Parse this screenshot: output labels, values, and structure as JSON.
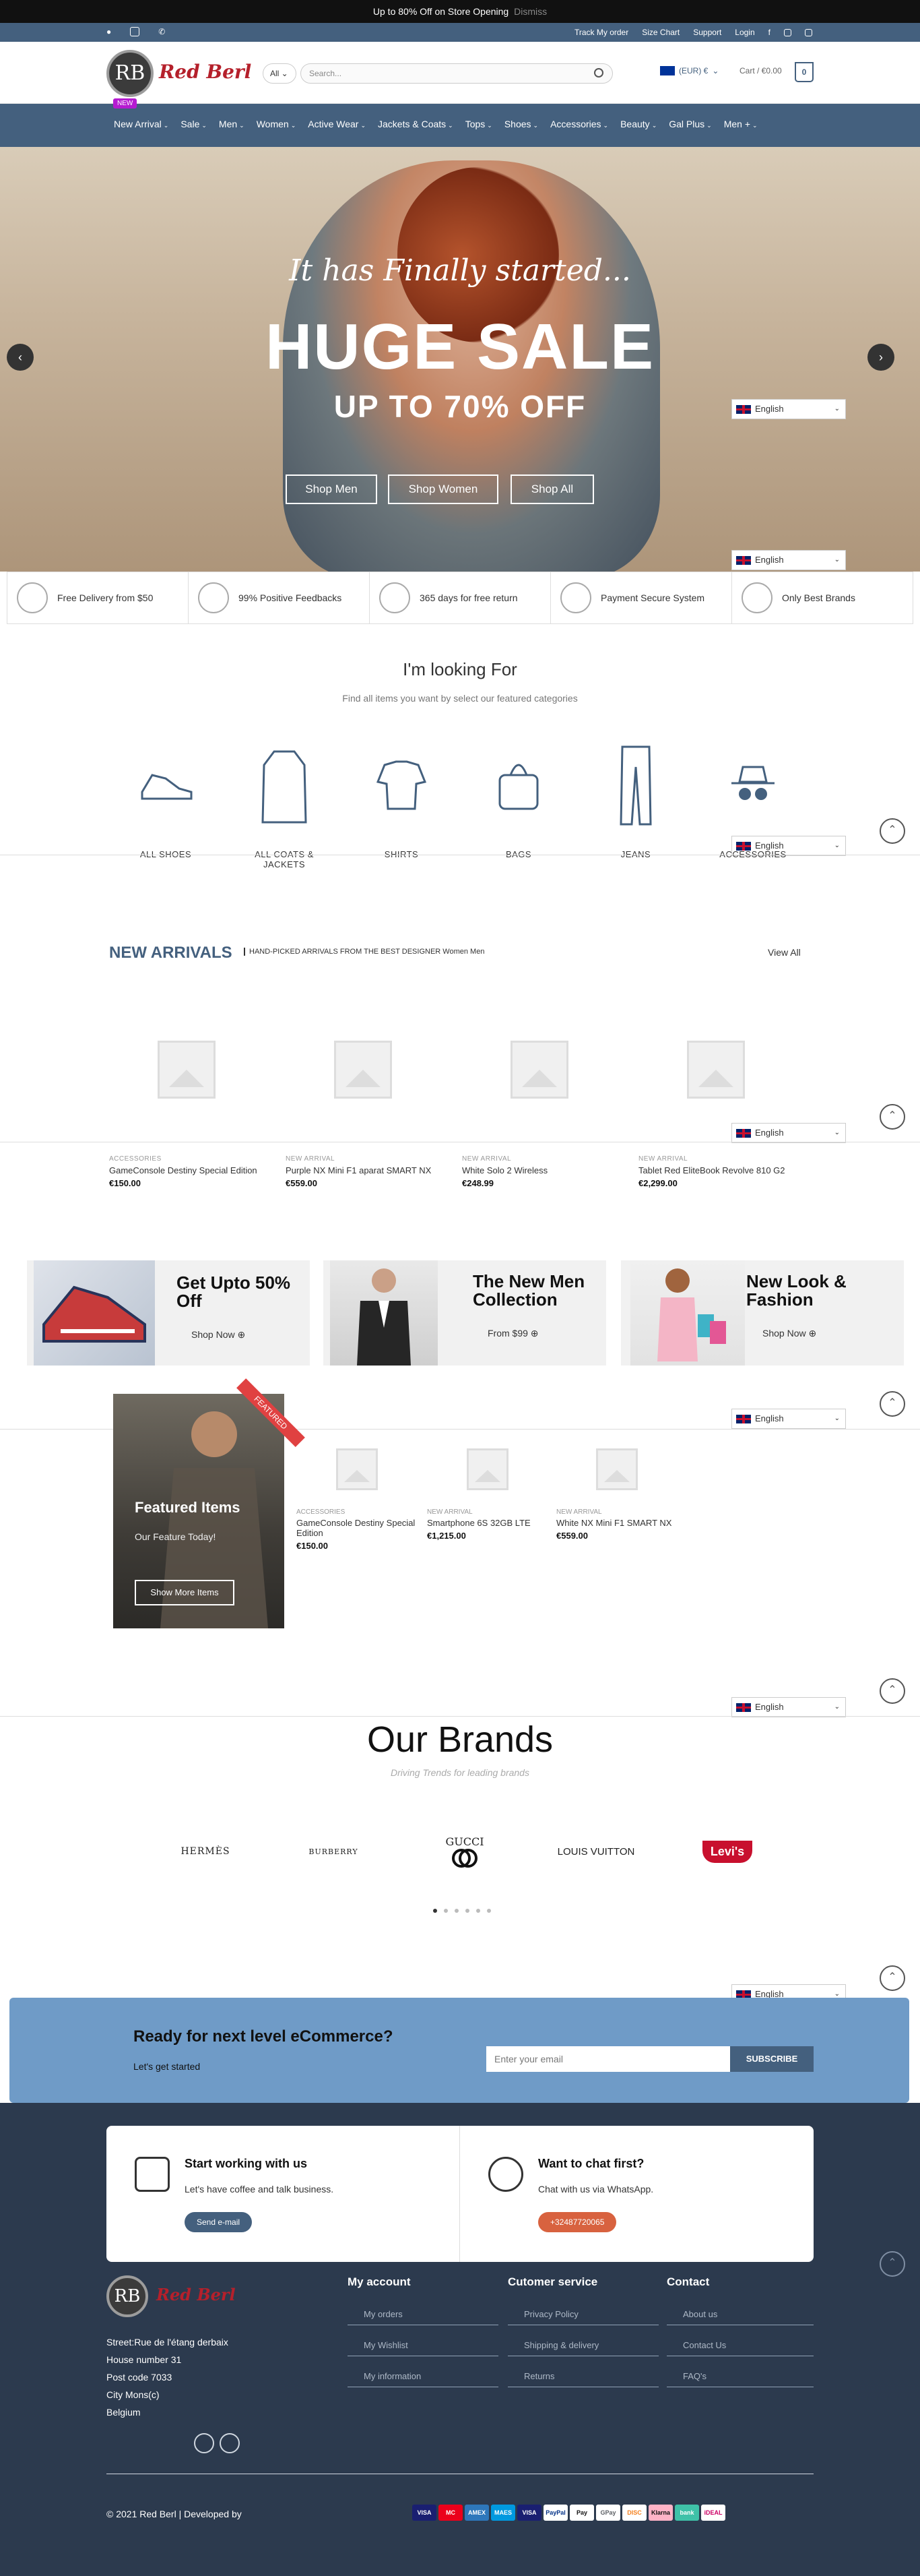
{
  "topbar": {
    "promo": "Up to 80% Off on Store Opening",
    "dismiss": "Dismiss"
  },
  "util_links": [
    "Track My order",
    "Size Chart",
    "Support",
    "Login"
  ],
  "header": {
    "logo_initials": "RB",
    "logo_text": "Red Berl",
    "category_select": "All",
    "search_placeholder": "Search...",
    "currency": "(EUR) €",
    "cart": "Cart / €0.00",
    "cart_count": "0"
  },
  "nav": {
    "badge": "NEW",
    "items": [
      "New Arrival",
      "Sale",
      "Men",
      "Women",
      "Active Wear",
      "Jackets & Coats",
      "Tops",
      "Shoes",
      "Accessories",
      "Beauty",
      "Gal Plus",
      "Men +"
    ]
  },
  "hero": {
    "script": "It has Finally started...",
    "headline": "HUGE SALE",
    "subheadline": "UP TO 70% OFF",
    "buttons": [
      "Shop Men",
      "Shop Women",
      "Shop All"
    ]
  },
  "language": "English",
  "features": [
    "Free Delivery from $50",
    "99% Positive Feedbacks",
    "365 days for free return",
    "Payment Secure System",
    "Only Best Brands"
  ],
  "categories": {
    "title": "I'm looking For",
    "subtitle": "Find all items you want by select our featured categories",
    "items": [
      "ALL SHOES",
      "ALL COATS & JACKETS",
      "SHIRTS",
      "BAGS",
      "JEANS",
      "ACCESSORIES"
    ]
  },
  "new_arrivals": {
    "title": "NEW ARRIVALS",
    "subtitle": "HAND-PICKED ARRIVALS FROM THE BEST DESIGNER Women Men",
    "view_all": "View All",
    "products": [
      {
        "category": "ACCESSORIES",
        "name": "GameConsole Destiny Special Edition",
        "price": "€150.00"
      },
      {
        "category": "NEW ARRIVAL",
        "name": "Purple NX Mini F1 aparat SMART NX",
        "price": "€559.00"
      },
      {
        "category": "NEW ARRIVAL",
        "name": "White Solo 2 Wireless",
        "price": "€248.99"
      },
      {
        "category": "NEW ARRIVAL",
        "name": "Tablet Red EliteBook Revolve 810 G2",
        "price": "€2,299.00"
      }
    ]
  },
  "promos": [
    {
      "title": "Get Upto 50% Off",
      "cta": "Shop Now"
    },
    {
      "title": "The New Men Collection",
      "cta": "From $99"
    },
    {
      "title": "New Look & Fashion",
      "cta": "Shop Now"
    }
  ],
  "featured": {
    "ribbon": "FEATURED",
    "title": "Featured Items",
    "text": "Our Feature Today!",
    "button": "Show More Items",
    "products": [
      {
        "category": "ACCESSORIES",
        "name": "GameConsole Destiny Special Edition",
        "price": "€150.00"
      },
      {
        "category": "NEW ARRIVAL",
        "name": "Smartphone 6S 32GB LTE",
        "price": "€1,215.00"
      },
      {
        "category": "NEW ARRIVAL",
        "name": "White NX Mini F1 SMART NX",
        "price": "€559.00"
      }
    ]
  },
  "brands": {
    "title": "Our Brands",
    "subtitle": "Driving Trends for leading brands",
    "items": [
      "HERMÈS",
      "BURBERRY",
      "GUCCI",
      "LOUIS VUITTON",
      "Levi's"
    ]
  },
  "newsletter": {
    "title": "Ready for next level eCommerce?",
    "text": "Let's get started",
    "placeholder": "Enter your email",
    "button": "SUBSCRIBE"
  },
  "contact": [
    {
      "title": "Start working with us",
      "text": "Let's have coffee and talk business.",
      "button": "Send e-mail"
    },
    {
      "title": "Want to chat first?",
      "text": "Chat with us via WhatsApp.",
      "button": "+32487720065"
    }
  ],
  "footer": {
    "address": [
      "Street:Rue de l'étang derbaix",
      "House number 31",
      "Post code 7033",
      "City Mons(c)",
      "Belgium"
    ],
    "columns": [
      {
        "title": "My account",
        "links": [
          "My orders",
          "My Wishlist",
          "My information"
        ]
      },
      {
        "title": "Cutomer service",
        "links": [
          "Privacy Policy",
          "Shipping & delivery",
          "Returns"
        ]
      },
      {
        "title": "Contact",
        "links": [
          "About us",
          "Contact Us",
          "FAQ's"
        ]
      }
    ],
    "copyright": "© 2021 Red Berl | Developed by",
    "payments": [
      "VISA",
      "MC",
      "AMEX",
      "MAES",
      "VISA",
      "PayPal",
      "Pay",
      "GPay",
      "DISC",
      "Klarna",
      "bank",
      "iDEAL"
    ]
  },
  "colors": {
    "brand": "#44607e",
    "accent": "#b5202b",
    "whatsapp_button": "#d8623f"
  }
}
